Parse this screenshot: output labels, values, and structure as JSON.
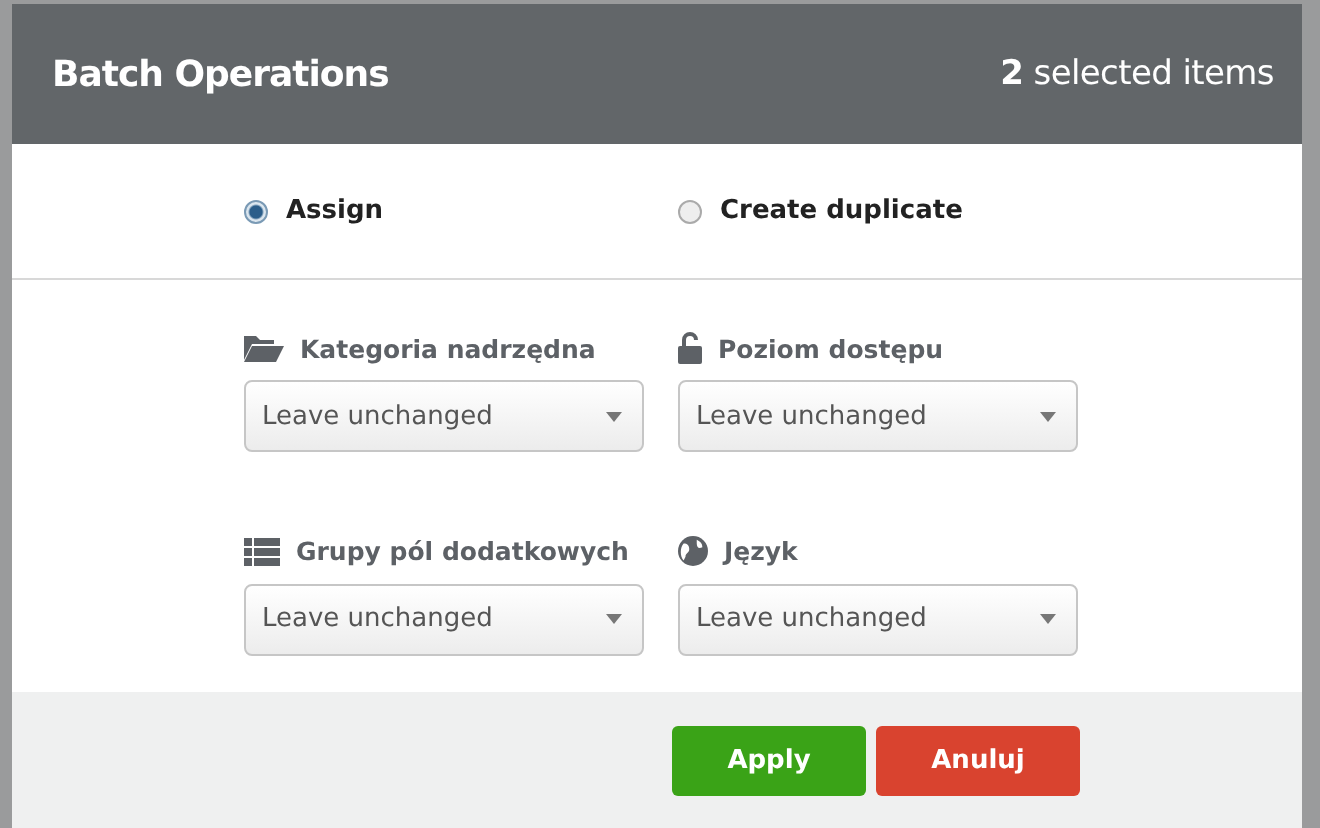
{
  "dialog": {
    "title": "Batch Operations",
    "selection_count": "**2** selected items"
  },
  "options": [
    {
      "label": "Assign",
      "selected": true
    },
    {
      "label": "Create duplicate",
      "selected": false
    }
  ],
  "fields": [
    {
      "kind": "folder",
      "label": "Kategoria nadrzędna",
      "value": "Leave unchanged"
    },
    {
      "kind": "lock",
      "label": "Poziom dostępu",
      "value": "Leave unchanged"
    },
    {
      "kind": "list",
      "label": "Grupy pól dodatkowych",
      "value": "Leave unchanged"
    },
    {
      "kind": "globe",
      "label": "Język",
      "value": "Leave unchanged"
    }
  ],
  "buttons": [
    {
      "kind": "primary",
      "label": "Apply"
    },
    {
      "kind": "danger",
      "label": "Anuluj"
    }
  ]
}
